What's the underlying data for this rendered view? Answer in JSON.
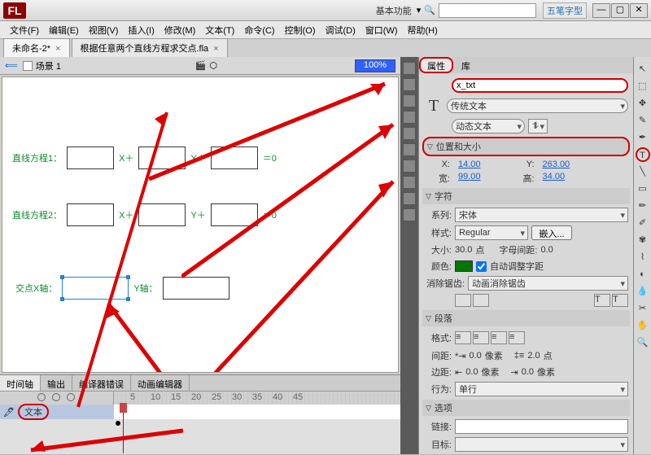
{
  "titlebar": {
    "logo": "FL",
    "mode": "基本功能",
    "ime": "五笔字型"
  },
  "menu": [
    "文件(F)",
    "编辑(E)",
    "视图(V)",
    "插入(I)",
    "修改(M)",
    "文本(T)",
    "命令(C)",
    "控制(O)",
    "调试(D)",
    "窗口(W)",
    "帮助(H)"
  ],
  "doctabs": [
    {
      "label": "未命名-2*"
    },
    {
      "label": "根据任意两个直线方程求交点.fla"
    }
  ],
  "scene": {
    "name": "场景 1",
    "zoom": "100%"
  },
  "stage": {
    "eq1_label": "直线方程1：",
    "eq2_label": "直线方程2：",
    "plus_x": "X＋",
    "plus_y": "Y＋",
    "eq_zero": "＝0",
    "xaxis": "交点X轴：",
    "yaxis": "Y轴："
  },
  "timeline": {
    "tabs": [
      "时间轴",
      "输出",
      "编译器错误",
      "动画编辑器"
    ],
    "layer": "文本",
    "frames": [
      "5",
      "10",
      "15",
      "20",
      "25",
      "30",
      "35",
      "40",
      "45"
    ]
  },
  "props": {
    "tabs": [
      "属性",
      "库"
    ],
    "instance_name": "x_txt",
    "text_engine": "传统文本",
    "text_type": "动态文本",
    "sec_pos": "位置和大小",
    "x_label": "X:",
    "x_val": "14.00",
    "y_label": "Y:",
    "y_val": "263.00",
    "w_label": "宽:",
    "w_val": "99.00",
    "h_label": "高:",
    "h_val": "34.00",
    "sec_char": "字符",
    "family_label": "系列:",
    "family_val": "宋体",
    "style_label": "样式:",
    "style_val": "Regular",
    "embed_btn": "嵌入...",
    "size_label": "大小:",
    "size_val": "30.0",
    "size_unit": "点",
    "spacing_label": "字母间距:",
    "spacing_val": "0.0",
    "color_label": "颜色:",
    "auto_kern": "自动调整字距",
    "aa_label": "消除锯齿:",
    "aa_val": "动画消除锯齿",
    "sec_para": "段落",
    "fmt_label": "格式:",
    "indent_label": "间距:",
    "indent_val": "0.0",
    "indent_unit": "像素",
    "leading_val": "2.0",
    "leading_unit": "点",
    "margin_label": "边距:",
    "margin_l": "0.0",
    "margin_unit": "像素",
    "margin_r": "0.0",
    "behavior_label": "行为:",
    "behavior_val": "单行",
    "sec_opt": "选项",
    "link_label": "链接:",
    "target_label": "目标:"
  },
  "tools": [
    "↖",
    "⬚",
    "✥",
    "✎",
    "T",
    "╲",
    "▭",
    "◯",
    "✏",
    "✐",
    "◐",
    "✂",
    "⟲",
    "🔍"
  ]
}
